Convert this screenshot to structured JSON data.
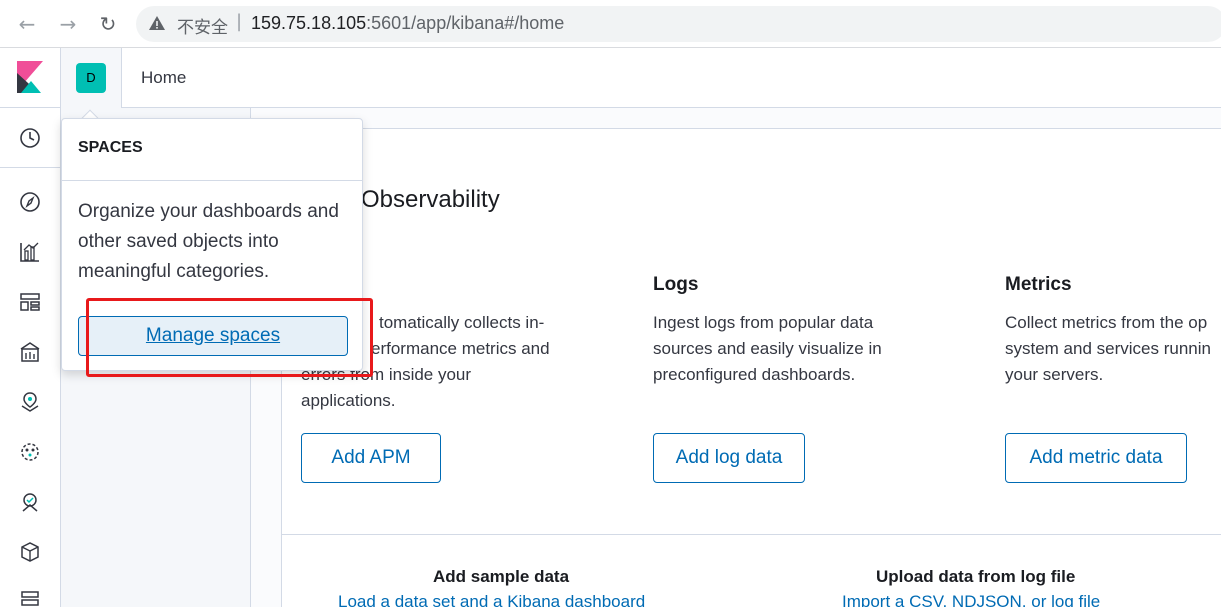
{
  "browser": {
    "insecure_label": "不安全",
    "separator": "|",
    "url_host": "159.75.18.105",
    "url_rest": ":5601/app/kibana#/home"
  },
  "header": {
    "space_initial": "D",
    "breadcrumb": "Home"
  },
  "popover": {
    "title": "SPACES",
    "description": "Organize your dashboards and other saved objects into meaningful categories.",
    "manage_button": "Manage spaces"
  },
  "main": {
    "section_title": "Observability",
    "cards": [
      {
        "title": "",
        "description_lines": [
          "tomatically collects in-",
          "erformance metrics and",
          "errors from inside your",
          "applications."
        ],
        "button": "Add APM"
      },
      {
        "title": "Logs",
        "description_lines": [
          "Ingest logs from popular data",
          "sources and easily visualize in",
          "preconfigured dashboards."
        ],
        "button": "Add log data"
      },
      {
        "title": "Metrics",
        "description_lines": [
          "Collect metrics from the op",
          "system and services runnin",
          "your servers."
        ],
        "button": "Add metric data"
      }
    ],
    "bottom": [
      {
        "title": "Add sample data",
        "link": "Load a data set and a Kibana dashboard"
      },
      {
        "title": "Upload data from log file",
        "link": "Import a CSV, NDJSON, or log file"
      }
    ]
  },
  "colors": {
    "accent": "#006bb4",
    "space_avatar": "#00bfb3",
    "highlight": "#e8191b"
  }
}
